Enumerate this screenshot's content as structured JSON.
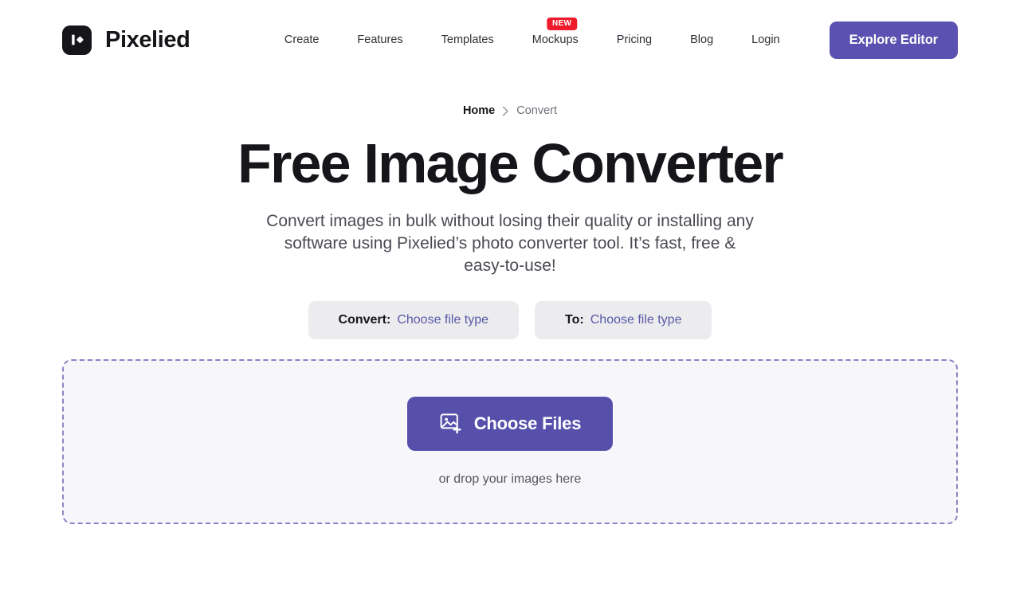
{
  "brand": {
    "name": "Pixelied",
    "logo_icon": "pixelied-logo-icon"
  },
  "header": {
    "nav_items": [
      {
        "label": "Create",
        "badge": null
      },
      {
        "label": "Features",
        "badge": null
      },
      {
        "label": "Templates",
        "badge": null
      },
      {
        "label": "Mockups",
        "badge": "NEW"
      },
      {
        "label": "Pricing",
        "badge": null
      },
      {
        "label": "Blog",
        "badge": null
      },
      {
        "label": "Login",
        "badge": null
      }
    ],
    "cta_label": "Explore Editor"
  },
  "breadcrumb": {
    "home": "Home",
    "separator": "chevron-right-icon",
    "current": "Convert"
  },
  "hero": {
    "title": "Free Image Converter",
    "subtitle": "Convert images in bulk without losing their quality or installing any software using Pixelied’s photo converter tool. It’s fast, free & easy-to-use!"
  },
  "selectors": [
    {
      "label": "Convert:",
      "value": "Choose file type"
    },
    {
      "label": "To:",
      "value": "Choose file type"
    }
  ],
  "dropzone": {
    "button_label": "Choose Files",
    "button_icon": "add-image-icon",
    "hint": "or drop your images here"
  },
  "colors": {
    "brand_purple": "#5b51b0",
    "button_purple": "#5650ab",
    "badge_red": "#ef1b2c",
    "selector_bg": "#ececee",
    "selector_value": "#5b58a8",
    "dropzone_bg": "#f7f6fb",
    "dropzone_border": "#8b84c4",
    "text_dark": "#16161a",
    "text_muted": "#6f7079"
  }
}
